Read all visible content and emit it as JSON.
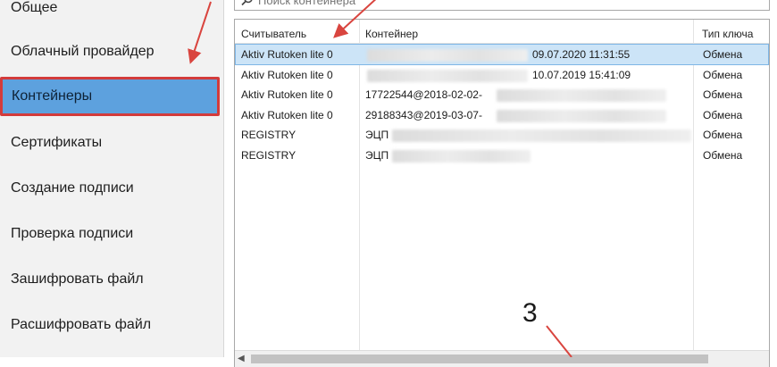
{
  "sidebar": {
    "items": [
      {
        "label": "Общее",
        "active": false
      },
      {
        "label": "Облачный провайдер",
        "active": false
      },
      {
        "label": "Контейнеры",
        "active": true
      },
      {
        "label": "Сертификаты",
        "active": false
      },
      {
        "label": "Создание подписи",
        "active": false
      },
      {
        "label": "Проверка подписи",
        "active": false
      },
      {
        "label": "Зашифровать файл",
        "active": false
      },
      {
        "label": "Расшифровать файл",
        "active": false
      }
    ]
  },
  "search": {
    "placeholder": "Поиск контейнера"
  },
  "table": {
    "columns": [
      "Считыватель",
      "Контейнер",
      "Тип ключа"
    ],
    "rows": [
      {
        "reader": "Aktiv Rutoken lite 0",
        "container": "",
        "date": "09.07.2020 11:31:55",
        "key_type": "Обмена",
        "selected": true
      },
      {
        "reader": "Aktiv Rutoken lite 0",
        "container": "",
        "date": "10.07.2019 15:41:09",
        "key_type": "Обмена",
        "selected": false
      },
      {
        "reader": "Aktiv Rutoken lite 0",
        "container": "17722544@2018-02-02-",
        "date": "",
        "key_type": "Обмена",
        "selected": false
      },
      {
        "reader": "Aktiv Rutoken lite 0",
        "container": "29188343@2019-03-07-",
        "date": "",
        "key_type": "Обмена",
        "selected": false
      },
      {
        "reader": "REGISTRY",
        "container": "ЭЦП",
        "date": "",
        "key_type": "Обмена",
        "selected": false
      },
      {
        "reader": "REGISTRY",
        "container": "ЭЦП",
        "date": "",
        "key_type": "Обмена",
        "selected": false
      }
    ]
  },
  "annotations": {
    "number": "3",
    "arrow_color": "#d9453f"
  },
  "colors": {
    "active_bg": "#5da1de",
    "active_border": "#d33b3b",
    "selected_row": "#cce4f7"
  },
  "icons": {
    "search": "search-icon",
    "scroll_left": "chevron-left-icon"
  }
}
